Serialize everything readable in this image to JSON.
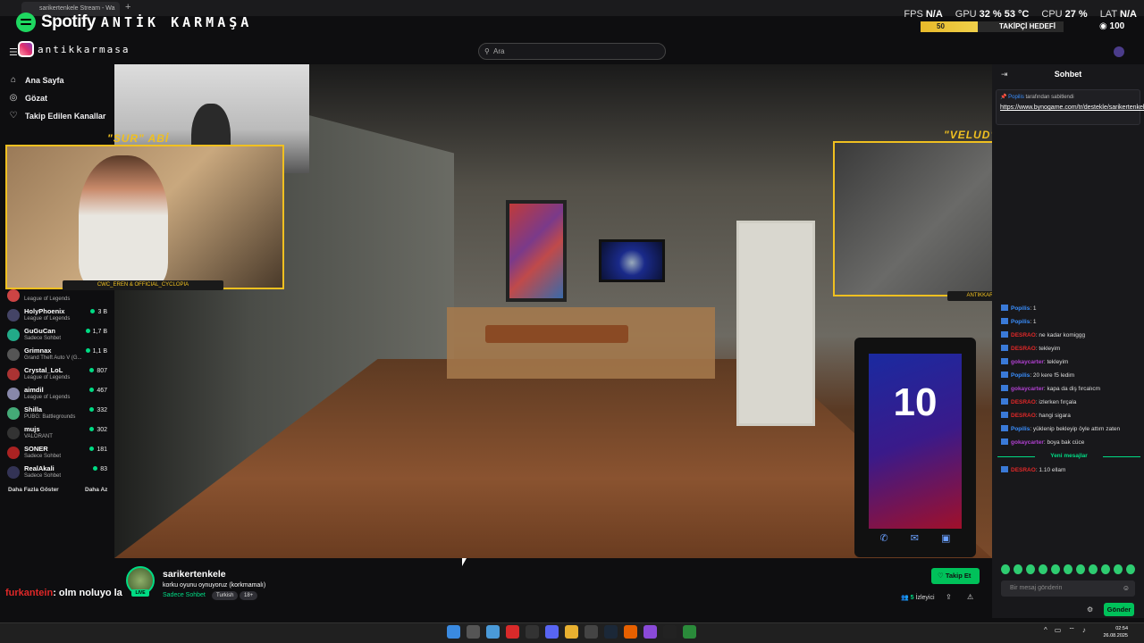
{
  "browser": {
    "tab_title": "sarikertenkele Stream - Wa",
    "new_tab": "+"
  },
  "overlay": {
    "spotify_brand": "Spotify",
    "spotify_track": "ANTİK KARMAŞA",
    "instagram_handle": "antikkarmasa",
    "stats": {
      "fps_label": "FPS",
      "fps": "N/A",
      "gpu_label": "GPU",
      "gpu": "32 % 53 °C",
      "cpu_label": "CPU",
      "cpu": "27 %",
      "lat_label": "LAT",
      "lat": "N/A"
    },
    "goal": {
      "current": "50",
      "label": "TAKİPÇİ HEDEFİ",
      "progress": 0.4,
      "target": "100"
    },
    "cam_sur_title": "\"SUR\" ABİ",
    "cam_sur_credit": "CWC_EREN & OFFICIAL_CYCLOPIA",
    "cam_velud_title": "\"VELUD\" ABİ",
    "cam_velud_credit": "ANTIKKARMASA",
    "phone_number": "10",
    "chat_line": {
      "user": "furkantein",
      "text": ": olm noluyo la"
    }
  },
  "header": {
    "search_placeholder": "Ara"
  },
  "nav": [
    {
      "label": "Ana Sayfa",
      "icon": "home-icon"
    },
    {
      "label": "Gözat",
      "icon": "compass-icon"
    },
    {
      "label": "Takip Edilen Kanallar",
      "icon": "heart-icon"
    }
  ],
  "channels": [
    {
      "name": "",
      "game": "League of Legends",
      "viewers": "",
      "color": "#c44"
    },
    {
      "name": "HolyPhoenix",
      "game": "League of Legends",
      "viewers": "3 B",
      "color": "#446"
    },
    {
      "name": "GuGuCan",
      "game": "Sadece Sohbet",
      "viewers": "1,7 B",
      "color": "#2a8"
    },
    {
      "name": "Grimnax",
      "game": "Grand Theft Auto V (G...",
      "viewers": "1,1 B",
      "color": "#555"
    },
    {
      "name": "Crystal_LoL",
      "game": "League of Legends",
      "viewers": "807",
      "color": "#a33"
    },
    {
      "name": "aimdil",
      "game": "League of Legends",
      "viewers": "467",
      "color": "#88a"
    },
    {
      "name": "Shilla",
      "game": "PUBG: Battlegrounds",
      "viewers": "332",
      "color": "#4a7"
    },
    {
      "name": "mujs",
      "game": "VALORANT",
      "viewers": "302",
      "color": "#333"
    },
    {
      "name": "SONER",
      "game": "Sadece Sohbet",
      "viewers": "181",
      "color": "#a22"
    },
    {
      "name": "RealAkali",
      "game": "Sadece Sohbet",
      "viewers": "83",
      "color": "#335"
    }
  ],
  "sidebar_more": "Daha Fazla Göster",
  "sidebar_less": "Daha Az",
  "chat": {
    "title": "Sohbet",
    "pinned_by": "Popilis",
    "pinned_by_suffix": " tarafından sabitlendi",
    "pinned_link": "https://www.bynogame.com/tr/destekle/sarikertenkele",
    "messages": [
      {
        "user": "Popilis",
        "text": ": 1",
        "color": "#3a8fff"
      },
      {
        "user": "Popilis",
        "text": ": 1",
        "color": "#3a8fff"
      },
      {
        "user": "DESRAO",
        "text": ": ne kadar komiggg",
        "color": "#e02828"
      },
      {
        "user": "DESRAO",
        "text": ": tekleyim",
        "color": "#e02828"
      },
      {
        "user": "gokaycarter",
        "text": ": tekleyim",
        "color": "#b040d0"
      },
      {
        "user": "Popilis",
        "text": ": 20 kere f5 ledim",
        "color": "#3a8fff"
      },
      {
        "user": "gokaycarter",
        "text": ": kapa da diş fırcalıcm",
        "color": "#b040d0"
      },
      {
        "user": "DESRAO",
        "text": ": izlerken fırçala",
        "color": "#e02828"
      },
      {
        "user": "DESRAO",
        "text": ": hangi sigara",
        "color": "#e02828"
      },
      {
        "user": "Popilis",
        "text": ": yüklenip bekleyip öyle attım zaten",
        "color": "#3a8fff"
      },
      {
        "user": "gokaycarter",
        "text": ": boya bak cüce",
        "color": "#b040d0"
      }
    ],
    "new_messages": "Yeni mesajlar",
    "after_messages": [
      {
        "user": "DESRAO",
        "text": ": 1.10 ellam",
        "color": "#e02828"
      }
    ],
    "input_placeholder": "Bir mesaj gönderin",
    "send_label": "Gönder"
  },
  "stream": {
    "channel": "sarikertenkele",
    "title": "korku oyunu oynuyoruz (korkmamalı)",
    "category": "Sadece Sohbet",
    "tags": [
      "Turkish",
      "18+"
    ],
    "live": "LIVE",
    "follow_label": "Takip Et",
    "viewers_count": "5",
    "viewers_label": "İzleyici"
  },
  "system": {
    "time": "02:54",
    "date": "26.08.2025"
  }
}
